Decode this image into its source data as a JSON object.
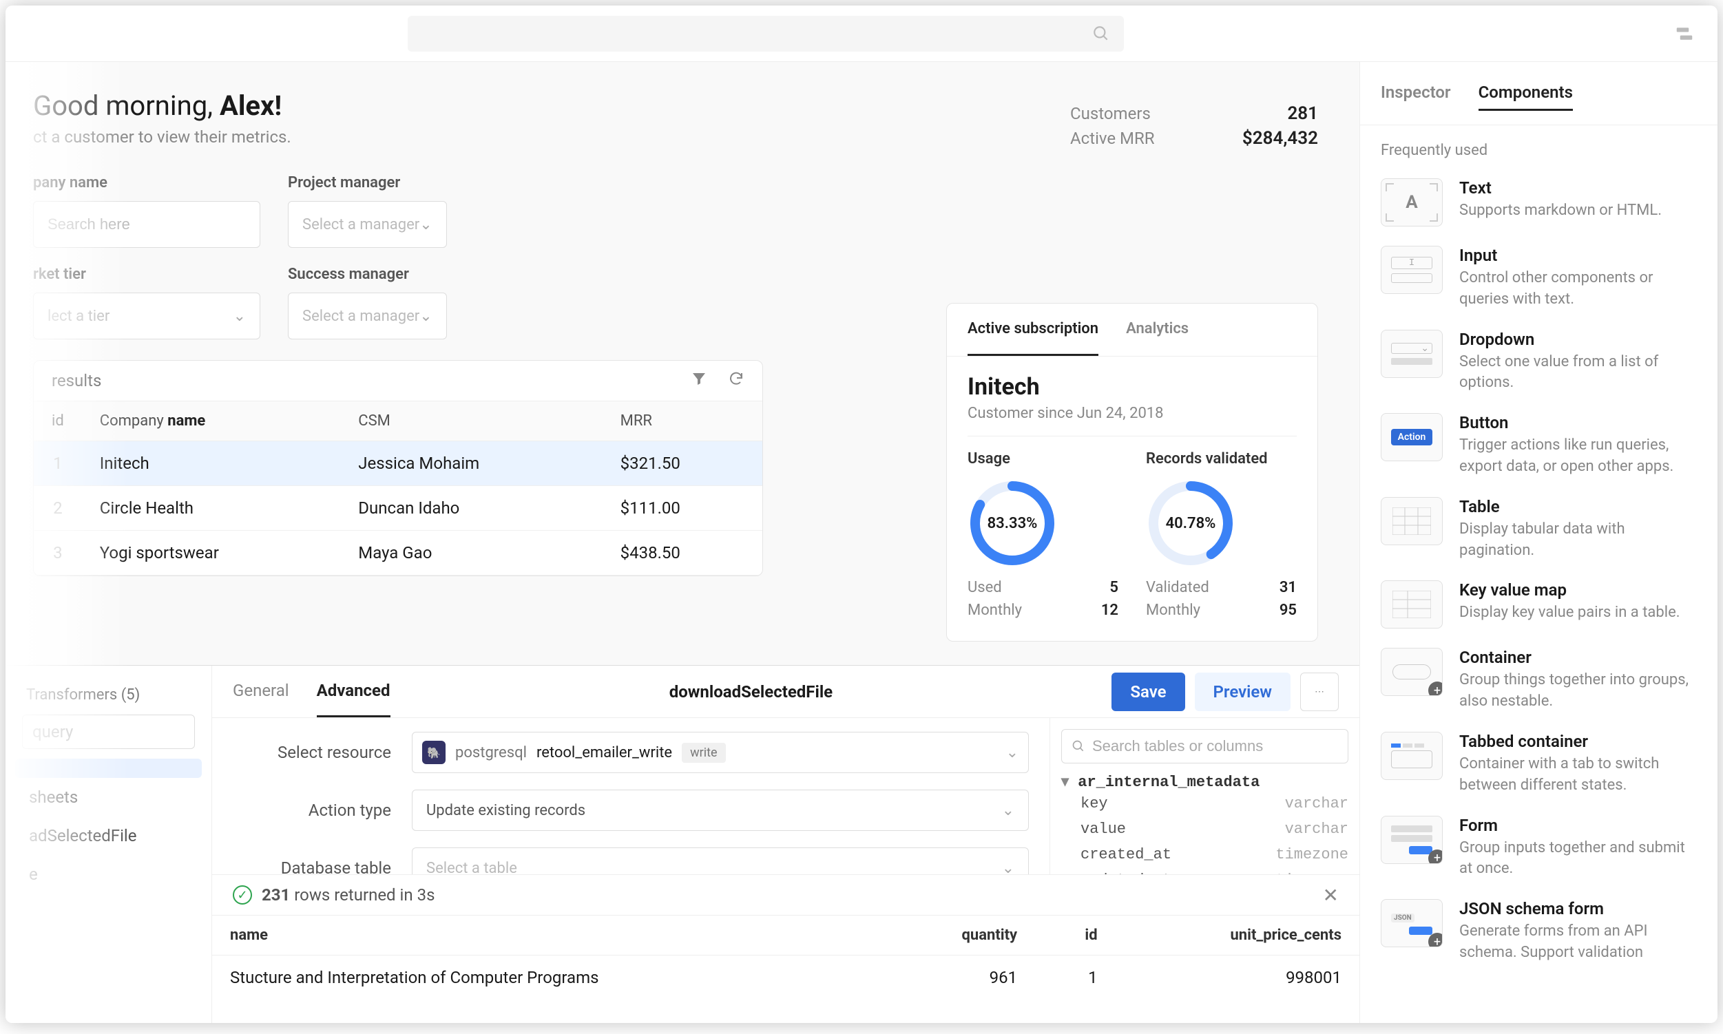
{
  "topbar": {
    "search_placeholder": ""
  },
  "header": {
    "greeting_prefix": "Good morning, ",
    "greeting_name": "Alex!",
    "subtitle": "ct a customer to view their metrics."
  },
  "stats": {
    "customers_label": "Customers",
    "customers_value": "281",
    "mrr_label": "Active MRR",
    "mrr_value": "$284,432"
  },
  "filters": {
    "company_label": "pany name",
    "company_placeholder": "Search here",
    "tier_label": "rket tier",
    "tier_placeholder": "lect a tier",
    "pm_label": "Project manager",
    "pm_placeholder": "Select a manager",
    "sm_label": "Success manager",
    "sm_placeholder": "Select a manager"
  },
  "results": {
    "title": " results",
    "col_id": "id",
    "col_company_a": "Company ",
    "col_company_b": "name",
    "col_csm": "CSM",
    "col_mrr": "MRR",
    "rows": [
      {
        "idx": "1",
        "company": "Initech",
        "csm": "Jessica Mohaim",
        "mrr": "$321.50",
        "selected": true
      },
      {
        "idx": "2",
        "company": "Circle Health",
        "csm": "Duncan Idaho",
        "mrr": "$111.00",
        "selected": false
      },
      {
        "idx": "3",
        "company": "Yogi sportswear",
        "csm": "Maya Gao",
        "mrr": "$438.50",
        "selected": false
      }
    ]
  },
  "subscription": {
    "tab_active": "Active subscription",
    "tab_analytics": "Analytics",
    "company": "Initech",
    "since": "Customer since Jun 24, 2018",
    "usage": {
      "label": "Usage",
      "pct": "83.33%",
      "pct_num": 83.33,
      "used_label": "Used",
      "used_value": "5",
      "monthly_label": "Monthly",
      "monthly_value": "12"
    },
    "records": {
      "label": "Records validated",
      "pct": "40.78%",
      "pct_num": 40.78,
      "validated_label": "Validated",
      "validated_value": "31",
      "monthly_label": "Monthly",
      "monthly_value": "95"
    }
  },
  "editor": {
    "left": {
      "heading": "Transformers (5)",
      "search_placeholder": "query",
      "items": [
        "",
        "sheets",
        "adSelectedFile",
        "e"
      ]
    },
    "tabs": {
      "general": "General",
      "advanced": "Advanced",
      "title": "downloadSelectedFile"
    },
    "actions": {
      "save": "Save",
      "preview": "Preview"
    },
    "form": {
      "resource_label": "Select resource",
      "resource_type": "postgresql",
      "resource_name": "retool_emailer_write",
      "resource_mode": "write",
      "action_label": "Action type",
      "action_value": "Update existing records",
      "table_label": "Database table",
      "table_placeholder": "Select a table"
    },
    "schema_search_placeholder": "Search tables or columns",
    "schema": {
      "table": "ar_internal_metadata",
      "cols": [
        {
          "n": "key",
          "t": "varchar"
        },
        {
          "n": "value",
          "t": "varchar"
        },
        {
          "n": "created_at",
          "t": "timezone"
        },
        {
          "n": "updated_at",
          "t": "timezone"
        }
      ]
    },
    "result_strip": {
      "count": "231",
      "rest": " rows returned in 3s"
    },
    "result_table": {
      "cols": [
        "name",
        "quantity",
        "id",
        "unit_price_cents"
      ],
      "row": {
        "name": "Stucture and Interpretation of Computer Programs",
        "quantity": "961",
        "id": "1",
        "unit_price_cents": "998001"
      }
    }
  },
  "rightbar": {
    "tab_inspector": "Inspector",
    "tab_components": "Components",
    "section": "Frequently used",
    "components": [
      {
        "name": "Text",
        "desc": "Supports markdown or HTML.",
        "kind": "text"
      },
      {
        "name": "Input",
        "desc": "Control other components or queries with text.",
        "kind": "input"
      },
      {
        "name": "Dropdown",
        "desc": "Select one value from a list of options.",
        "kind": "dropdown"
      },
      {
        "name": "Button",
        "desc": "Trigger actions like run queries, export data, or open other apps.",
        "kind": "button"
      },
      {
        "name": "Table",
        "desc": "Display tabular data with pagination.",
        "kind": "table"
      },
      {
        "name": "Key value map",
        "desc": "Display key value pairs in a table.",
        "kind": "kv"
      },
      {
        "name": "Container",
        "desc": "Group things together into groups, also nestable.",
        "kind": "container",
        "add": true
      },
      {
        "name": "Tabbed container",
        "desc": "Container with a tab to switch between different states.",
        "kind": "tabbed"
      },
      {
        "name": "Form",
        "desc": "Group inputs together and submit at once.",
        "kind": "form",
        "add": true
      },
      {
        "name": "JSON schema form",
        "desc": "Generate forms from an API schema. Support validation",
        "kind": "json",
        "add": true
      }
    ]
  }
}
